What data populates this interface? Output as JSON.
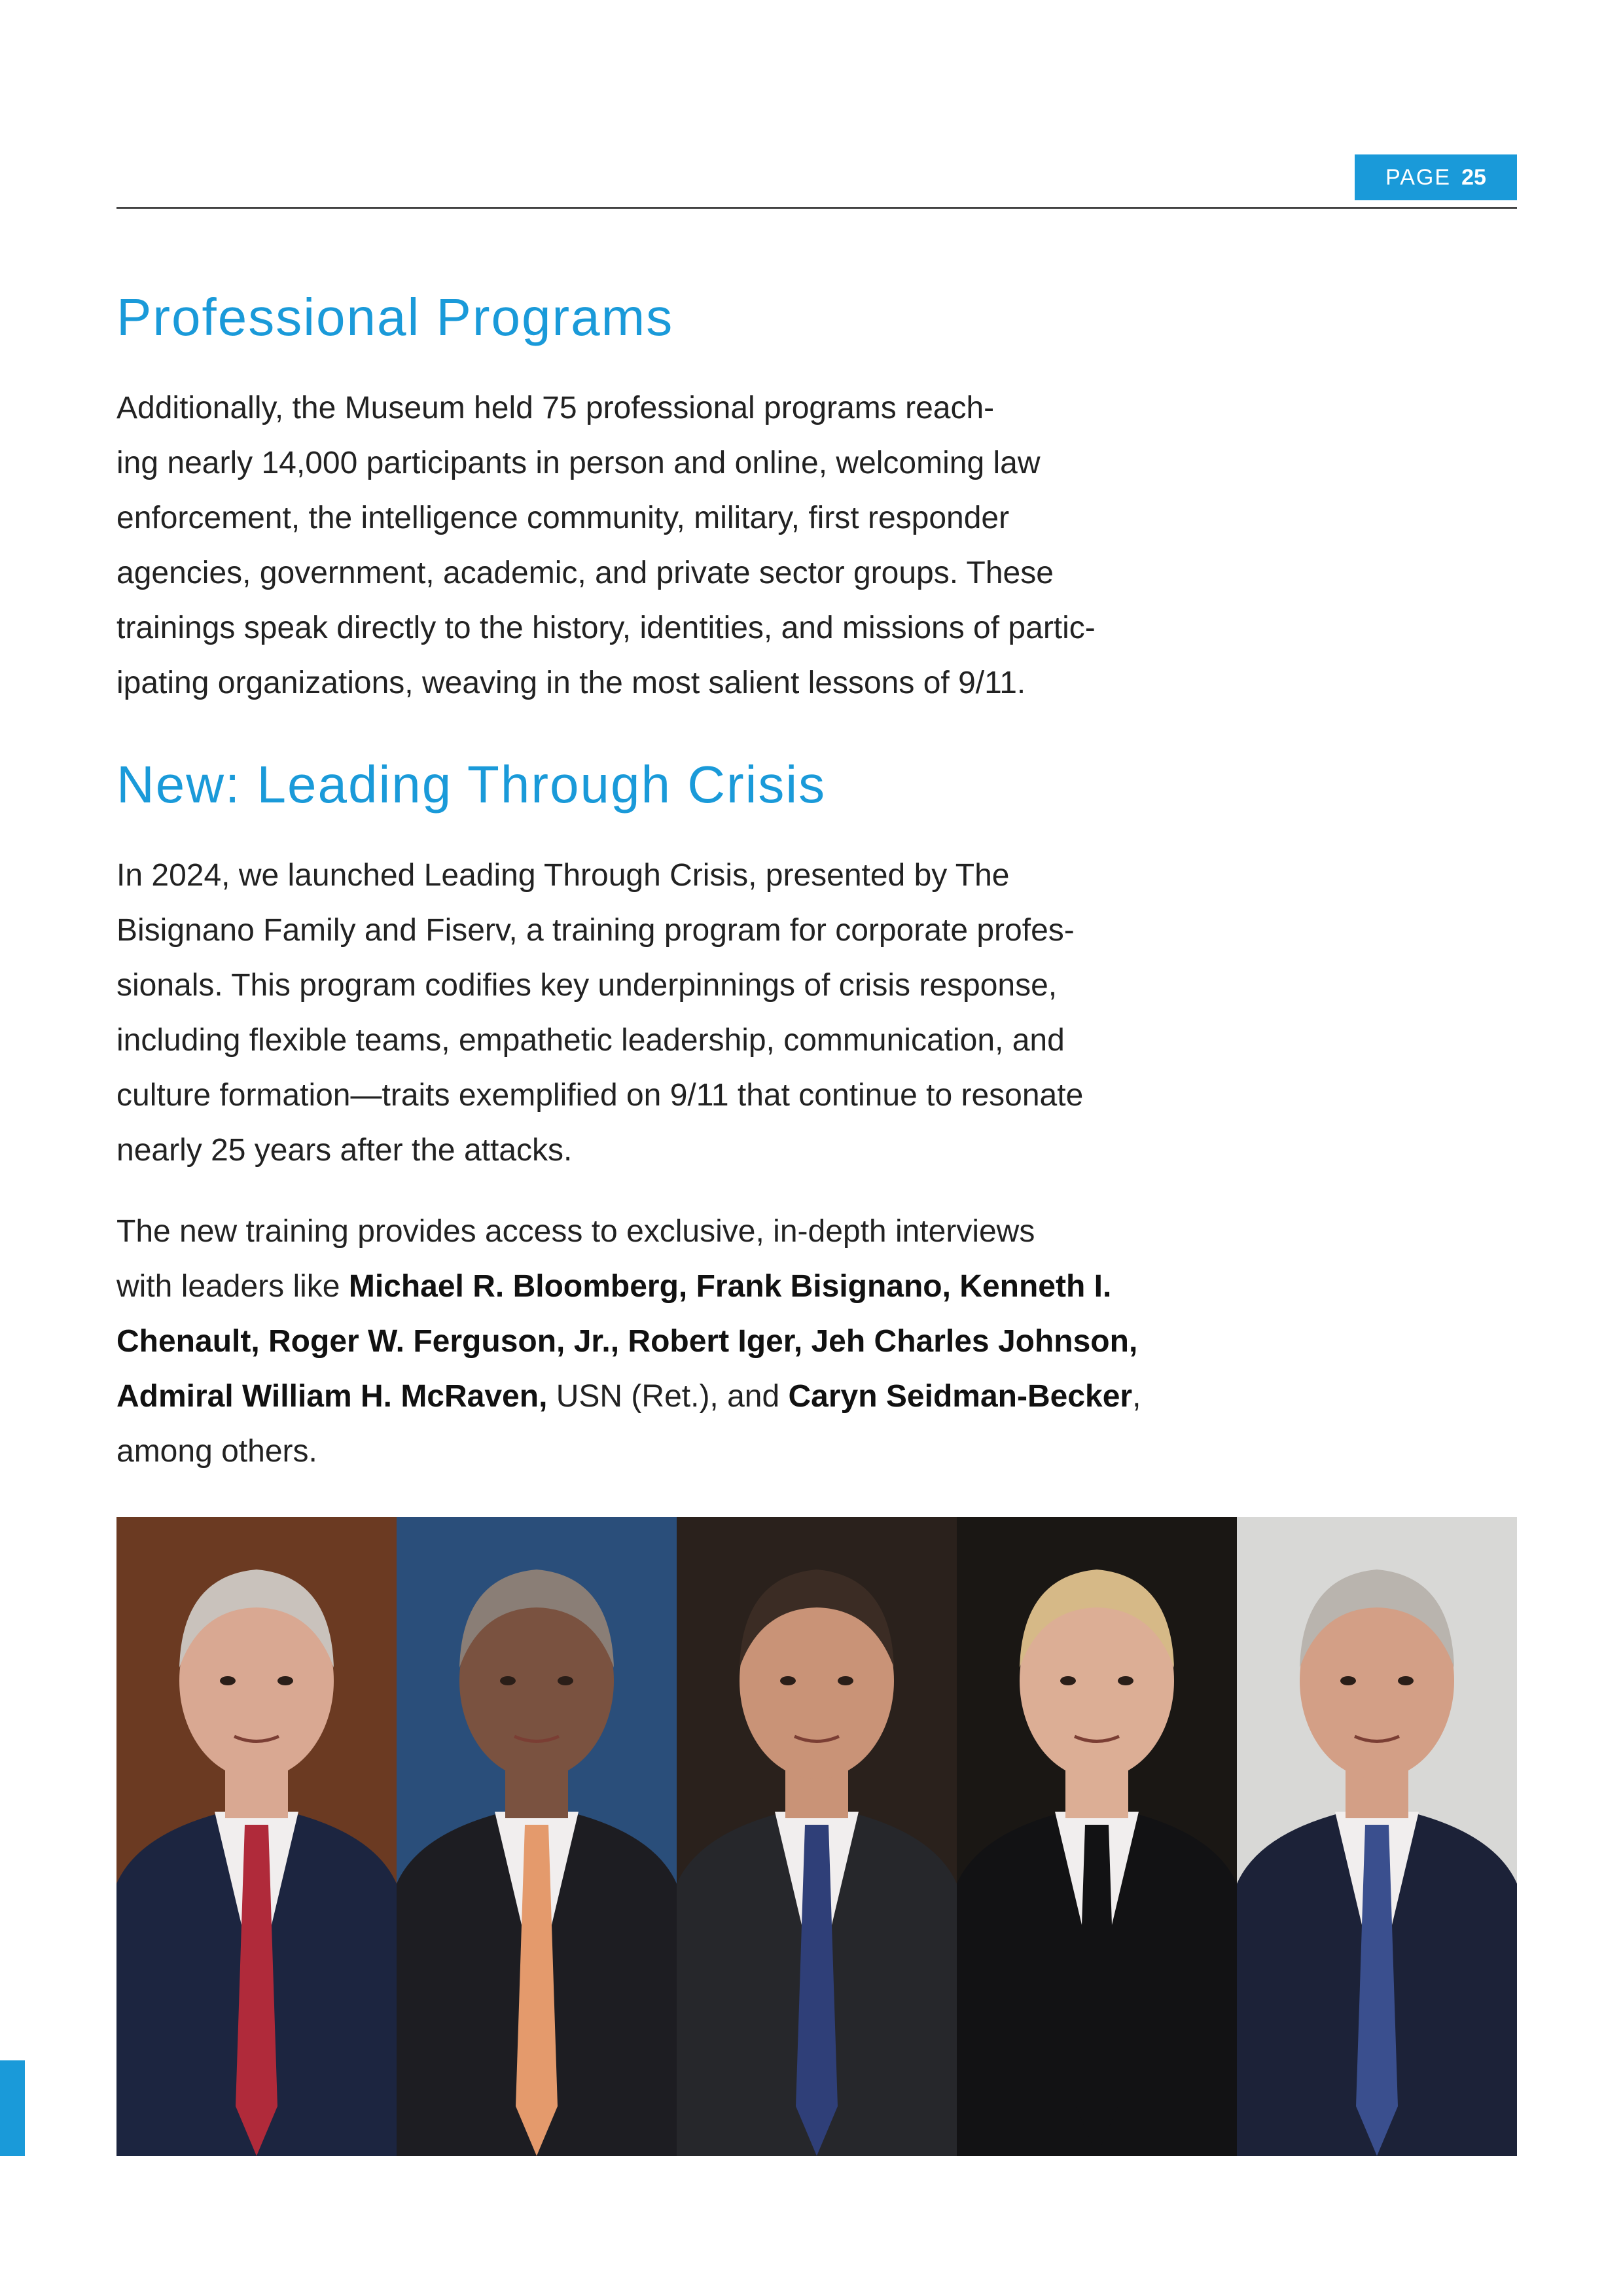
{
  "header": {
    "page_label": "PAGE",
    "page_number": "25"
  },
  "sections": [
    {
      "heading": "Professional Programs",
      "lines": [
        "Additionally, the Museum held 75 professional programs reach-",
        "ing nearly 14,000 participants in person and online, welcoming law",
        "enforcement, the intelligence community, military, first responder",
        "agencies, government, academic, and private sector groups. These",
        "trainings speak directly to the history, identities, and missions of partic-",
        "ipating organizations, weaving in the most salient lessons of 9/11."
      ]
    },
    {
      "heading": "New: Leading Through Crisis",
      "lines": [
        "In 2024, we launched Leading Through Crisis, presented by The",
        "Bisignano Family and Fiserv, a training program for corporate profes-",
        "sionals. This program codifies key underpinnings of crisis response,",
        "including flexible teams, empathetic leadership, communication, and",
        "culture formation—traits exemplified on 9/11 that continue to resonate",
        "nearly 25 years after the attacks."
      ],
      "interviews": {
        "line1": "The new training provides access to exclusive, in-depth interviews",
        "line2_prefix": "with leaders like ",
        "line2_bold": "Michael R. Bloomberg, Frank Bisignano, Kenneth I.",
        "line3_bold": "Chenault, Roger W. Ferguson, Jr., Robert Iger, Jeh Charles Johnson,",
        "line4_bold_a": "Admiral William H. McRaven,",
        "line4_mid": " USN (Ret.), and ",
        "line4_bold_b": "Caryn Seidman-Becker",
        "line4_suffix": ",",
        "line5": "among others."
      }
    }
  ],
  "photos": [
    {
      "icon": "portrait-photo",
      "bg": "#6b3a22",
      "suit": "#1c2540",
      "tie": "#b02a3a",
      "skin": "#d9a892",
      "hair": "#c9c2bc"
    },
    {
      "icon": "portrait-photo",
      "bg": "#2a4e7a",
      "suit": "#1d1d22",
      "tie": "#e49a6c",
      "skin": "#7a5240",
      "hair": "#8a7e76"
    },
    {
      "icon": "portrait-photo",
      "bg": "#2a211c",
      "suit": "#26272b",
      "tie": "#2f3f78",
      "skin": "#c99377",
      "hair": "#3b2c24"
    },
    {
      "icon": "portrait-photo",
      "bg": "#1a1714",
      "suit": "#121214",
      "tie": "#121214",
      "skin": "#dcae95",
      "hair": "#d6b987"
    },
    {
      "icon": "portrait-photo",
      "bg": "#d8d8d6",
      "suit": "#1c2238",
      "tie": "#3a4f8e",
      "skin": "#d39f86",
      "hair": "#b9b4ae"
    }
  ]
}
